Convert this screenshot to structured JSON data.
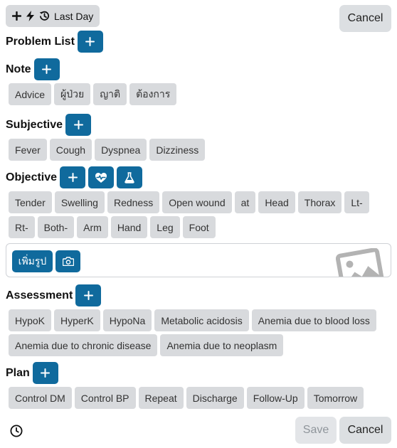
{
  "toolbar": {
    "last_day_label": "Last Day",
    "icons": [
      "plus-icon",
      "bolt-icon",
      "history-icon"
    ]
  },
  "header": {
    "cancel_label": "Cancel"
  },
  "sections": {
    "problem_list": {
      "title": "Problem List"
    },
    "note": {
      "title": "Note",
      "chips": [
        "Advice",
        "ผู้ป่วย",
        "ญาติ",
        "ต้องการ"
      ]
    },
    "subjective": {
      "title": "Subjective",
      "chips": [
        "Fever",
        "Cough",
        "Dyspnea",
        "Dizziness"
      ]
    },
    "objective": {
      "title": "Objective",
      "chips_row1": [
        "Tender",
        "Swelling",
        "Redness",
        "Open wound",
        "at",
        "Head",
        "Thorax",
        "Lt-"
      ],
      "chips_row2": [
        "Rt-",
        "Both-",
        "Arm",
        "Hand",
        "Leg",
        "Foot"
      ],
      "add_photo_label": "เพิ่มรูป"
    },
    "assessment": {
      "title": "Assessment",
      "chips_row1": [
        "HypoK",
        "HyperK",
        "HypoNa",
        "Metabolic acidosis",
        "Anemia due to blood loss"
      ],
      "chips_row2": [
        "Anemia due to chronic disease",
        "Anemia due to neoplasm"
      ]
    },
    "plan": {
      "title": "Plan",
      "chips": [
        "Control DM",
        "Control BP",
        "Repeat",
        "Discharge",
        "Follow-Up",
        "Tomorrow"
      ]
    }
  },
  "footer": {
    "save_label": "Save",
    "cancel_label": "Cancel"
  },
  "colors": {
    "accent": "#106a9d",
    "chip_bg": "#d8dadd",
    "button_bg": "#dcdfe2"
  }
}
